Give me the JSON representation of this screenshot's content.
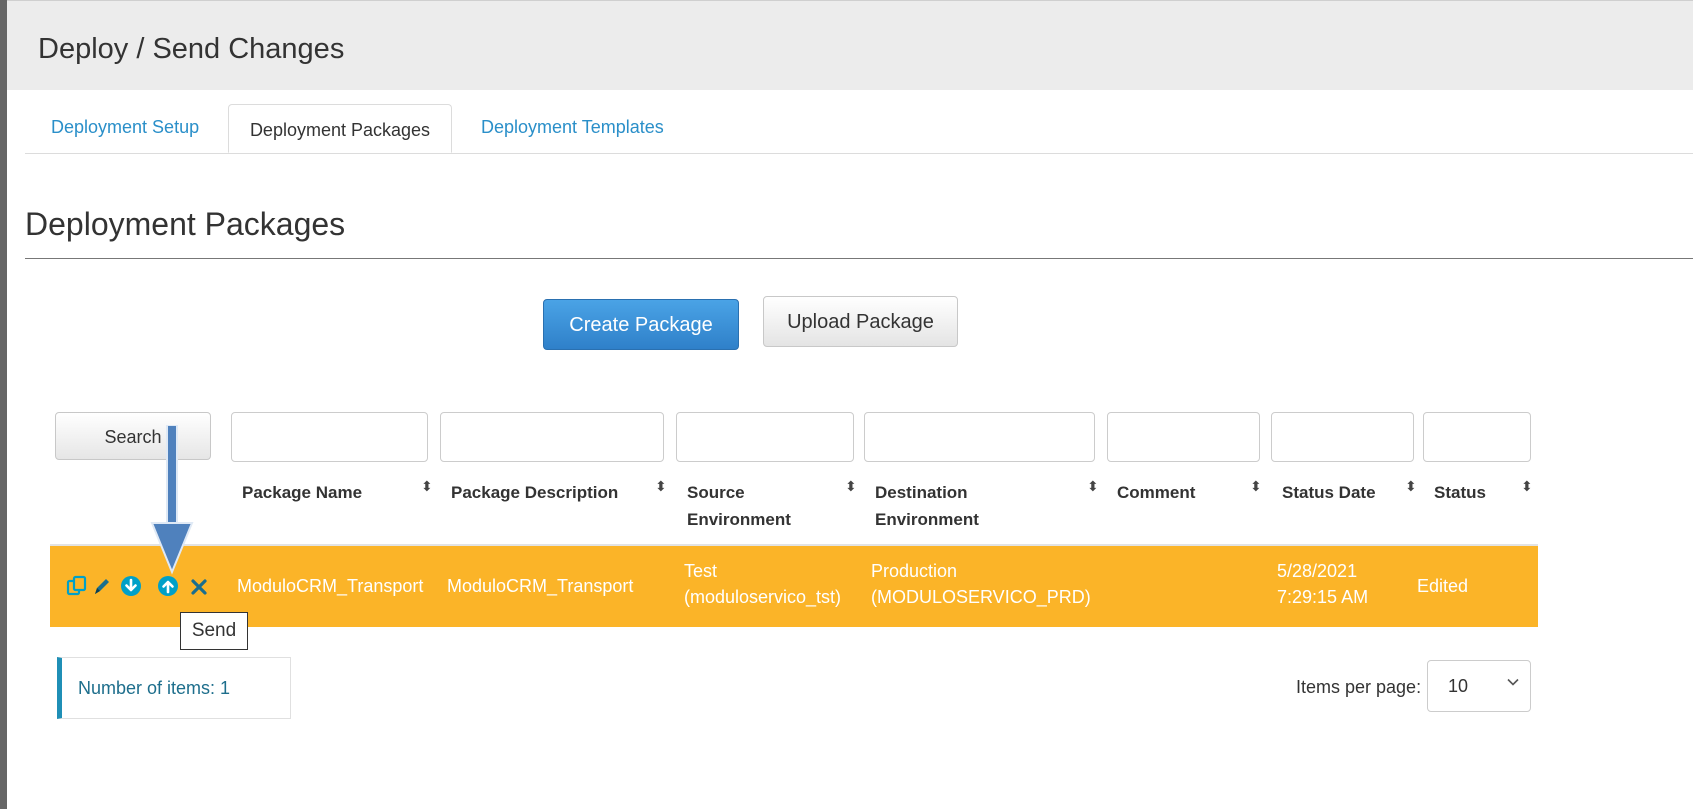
{
  "header": {
    "title": "Deploy / Send Changes"
  },
  "tabs": [
    {
      "label": "Deployment Setup",
      "active": false
    },
    {
      "label": "Deployment Packages",
      "active": true
    },
    {
      "label": "Deployment Templates",
      "active": false
    }
  ],
  "section": {
    "title": "Deployment Packages"
  },
  "buttons": {
    "create": "Create Package",
    "upload": "Upload Package",
    "search": "Search"
  },
  "table": {
    "columns": [
      [
        "Package Name"
      ],
      [
        "Package Description"
      ],
      [
        "Source",
        "Environment"
      ],
      [
        "Destination",
        "Environment"
      ],
      [
        "Comment"
      ],
      [
        "Status Date"
      ],
      [
        "Status"
      ]
    ],
    "rows": [
      {
        "package_name": "ModuloCRM_Transport",
        "package_description": "ModuloCRM_Transport",
        "source_line1": "Test",
        "source_line2": "(moduloservico_tst)",
        "destination_line1": "Production",
        "destination_line2": "(MODULOSERVICO_PRD)",
        "comment": "",
        "status_date_line1": "5/28/2021",
        "status_date_line2": "7:29:15 AM",
        "status": "Edited",
        "row_color": "#fbb428",
        "actions": [
          "copy-icon",
          "edit-icon",
          "download-icon",
          "send-icon",
          "delete-icon"
        ]
      }
    ]
  },
  "tooltip": {
    "text": "Send"
  },
  "footer": {
    "items_count": "Number of items: 1",
    "items_per_page_label": "Items per page:",
    "items_per_page_value": "10"
  },
  "colors": {
    "accent": "#2a8fc9",
    "primary_button": "#3a8fd6",
    "row_highlight": "#fbb428",
    "icon": "#00a0c8",
    "annotation_arrow": "#4f81bd"
  }
}
